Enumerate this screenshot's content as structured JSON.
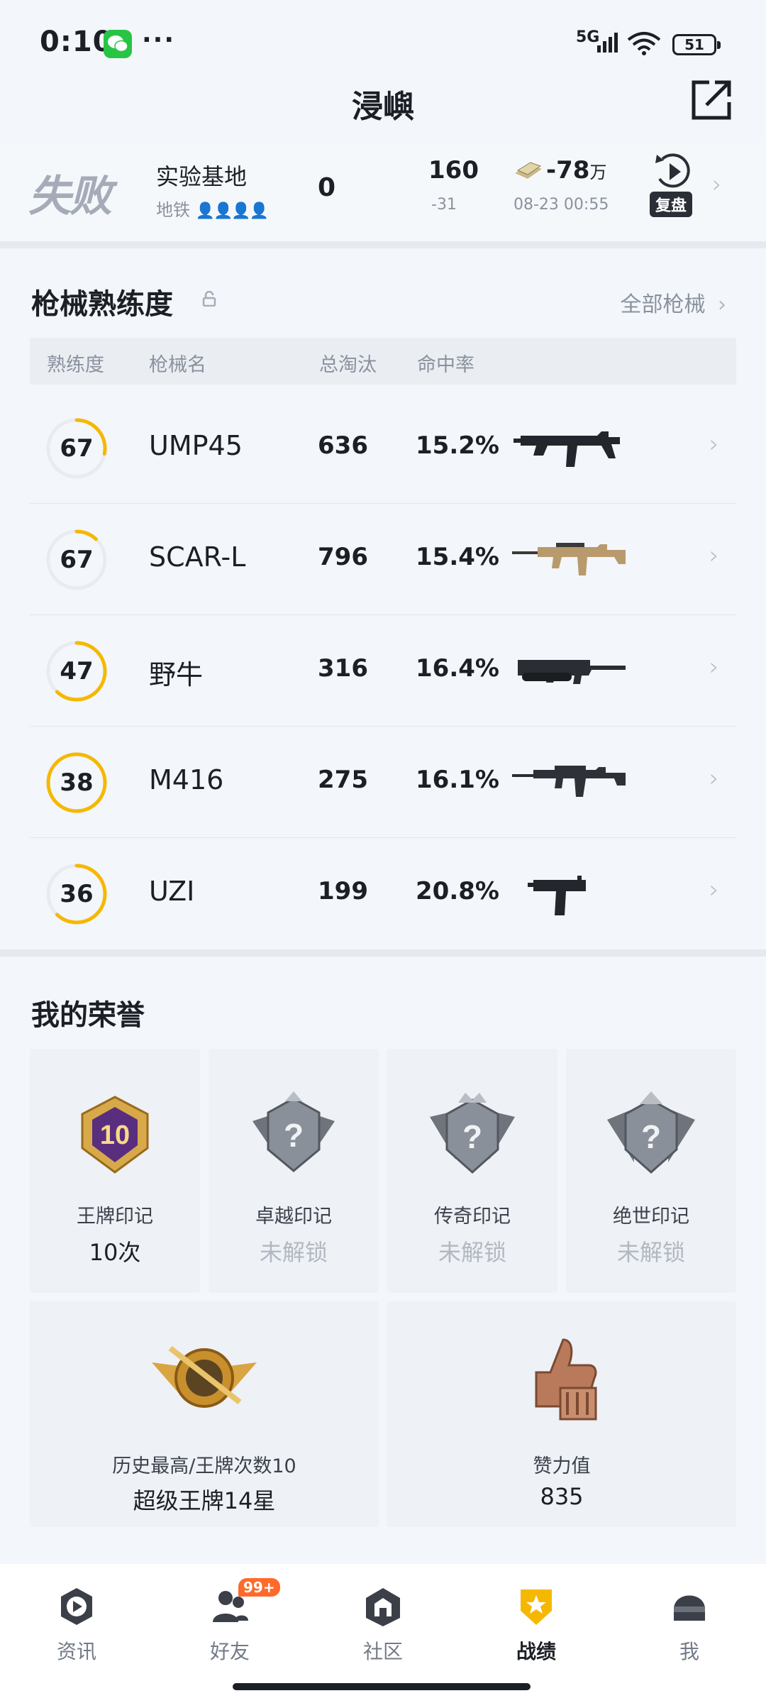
{
  "status_bar": {
    "time": "0:10",
    "dots": "···",
    "network": "5G",
    "battery": "51"
  },
  "header": {
    "title": "浸嶼"
  },
  "match": {
    "result": "失败",
    "map": "实验基地",
    "mode": "地铁",
    "kills": "0",
    "score": "160",
    "score_delta": "-31",
    "money": "-78",
    "money_unit": "万",
    "date": "08-23 00:55",
    "replay_label": "复盘"
  },
  "weapons": {
    "title": "枪械熟练度",
    "all_link": "全部枪械",
    "columns": [
      "熟练度",
      "枪械名",
      "总淘汰",
      "命中率"
    ],
    "rows": [
      {
        "proficiency": "67",
        "progress": 0.28,
        "name": "UMP45",
        "kills": "636",
        "rate": "15.2%",
        "icon": "smg-ump45-icon"
      },
      {
        "proficiency": "67",
        "progress": 0.12,
        "name": "SCAR-L",
        "kills": "796",
        "rate": "15.4%",
        "icon": "rifle-scar-icon"
      },
      {
        "proficiency": "47",
        "progress": 0.62,
        "name": "野牛",
        "kills": "316",
        "rate": "16.4%",
        "icon": "smg-bizon-icon"
      },
      {
        "proficiency": "38",
        "progress": 1.0,
        "name": "M416",
        "kills": "275",
        "rate": "16.1%",
        "icon": "rifle-m416-icon"
      },
      {
        "proficiency": "36",
        "progress": 0.62,
        "name": "UZI",
        "kills": "199",
        "rate": "20.8%",
        "icon": "smg-uzi-icon"
      }
    ]
  },
  "honors": {
    "title": "我的荣誉",
    "marks": [
      {
        "label": "王牌印记",
        "value": "10次",
        "locked": false,
        "emblem_text": "10"
      },
      {
        "label": "卓越印记",
        "value": "未解锁",
        "locked": true,
        "emblem_text": "?"
      },
      {
        "label": "传奇印记",
        "value": "未解锁",
        "locked": true,
        "emblem_text": "?"
      },
      {
        "label": "绝世印记",
        "value": "未解锁",
        "locked": true,
        "emblem_text": "?"
      }
    ],
    "best": {
      "label": "历史最高/王牌次数10",
      "value": "超级王牌14星"
    },
    "likes": {
      "label": "赞力值",
      "value": "835"
    }
  },
  "tabs": [
    {
      "label": "资讯",
      "icon": "news-icon"
    },
    {
      "label": "好友",
      "icon": "friends-icon",
      "badge": "99+"
    },
    {
      "label": "社区",
      "icon": "community-icon"
    },
    {
      "label": "战绩",
      "icon": "record-icon",
      "active": true
    },
    {
      "label": "我",
      "icon": "me-icon"
    }
  ],
  "colors": {
    "accent": "#f5b800",
    "ring_track": "#e8ebef",
    "background": "#f3f6fa"
  }
}
